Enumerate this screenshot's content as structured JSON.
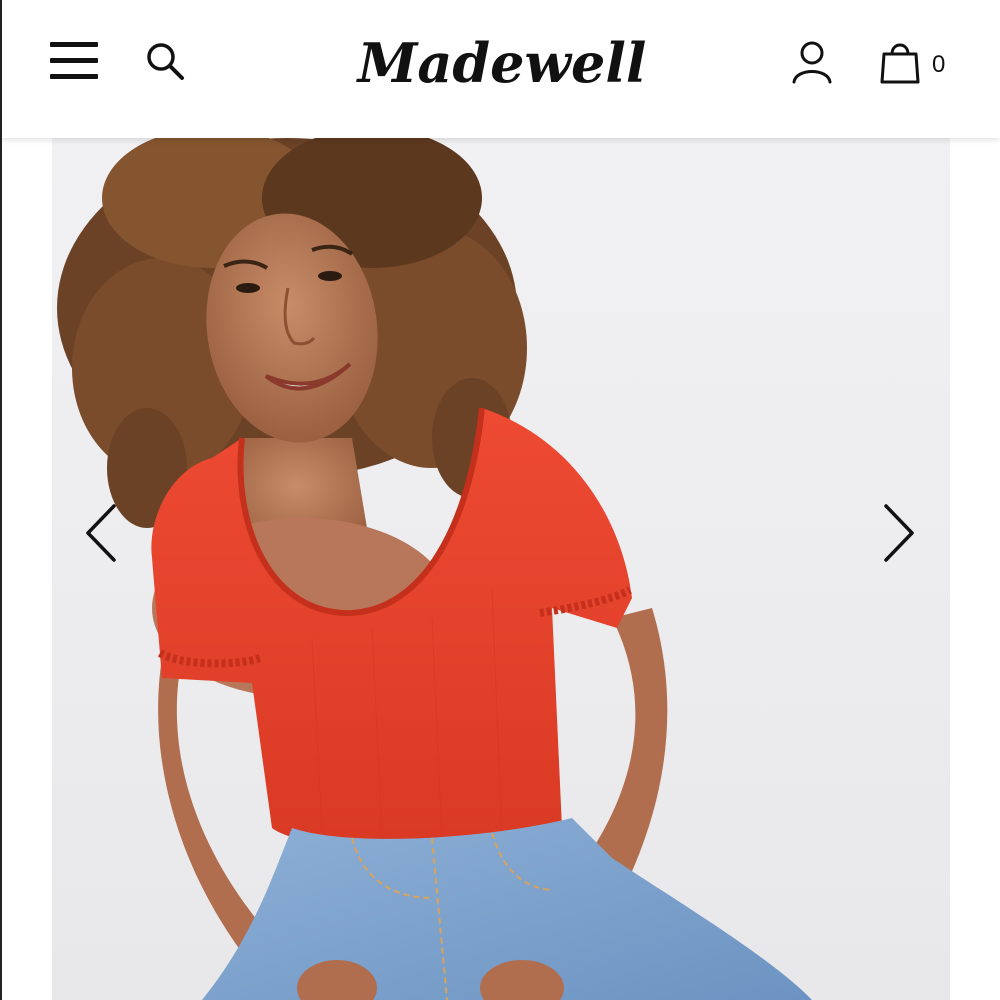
{
  "header": {
    "brand": "Madewell",
    "bag_count": "0",
    "icons": {
      "menu": "hamburger-menu-icon",
      "search": "search-icon",
      "account": "account-icon",
      "bag": "shopping-bag-icon"
    }
  },
  "carousel": {
    "image": "product-photo",
    "prev": "chevron-left-icon",
    "next": "chevron-right-icon",
    "colors": {
      "top": "#e8402b",
      "denim": "#7fa4cd",
      "background": "#eeeef0"
    }
  }
}
